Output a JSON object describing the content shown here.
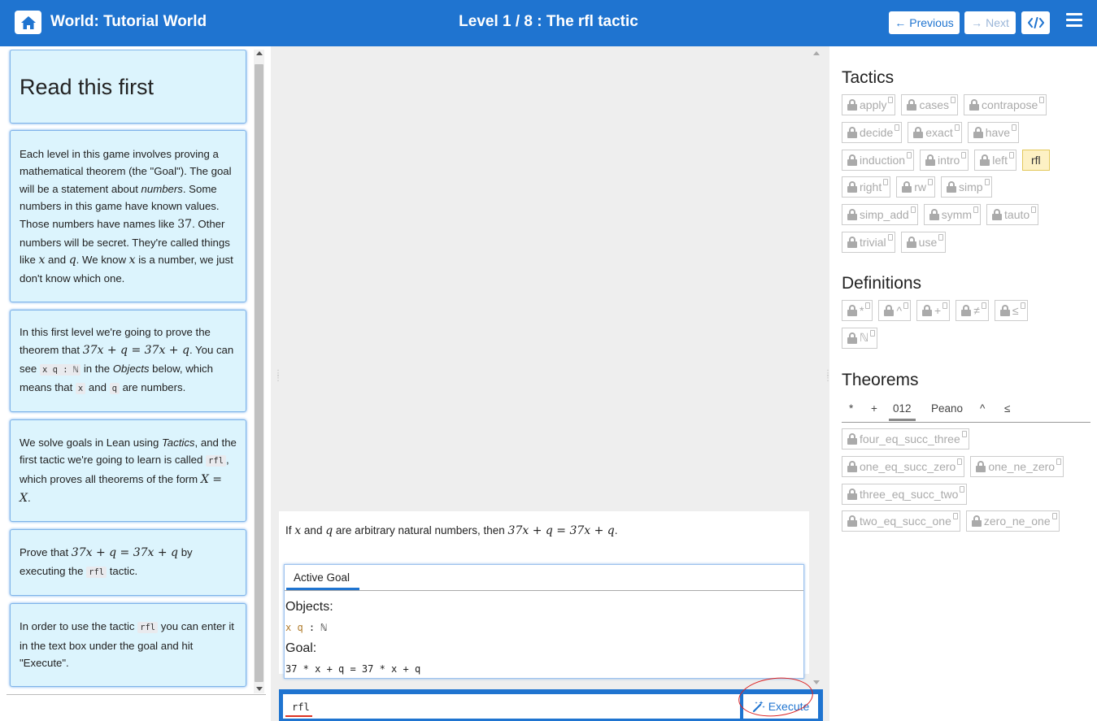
{
  "header": {
    "world_title": "World: Tutorial World",
    "level_title": "Level 1 / 8 : The rfl tactic",
    "previous_label": "Previous",
    "next_label": "Next"
  },
  "intro": {
    "title": "Read this first",
    "p1": {
      "a": "Each level in this game involves proving a mathematical theorem (the \"Goal\"). The goal will be a statement about ",
      "numbers": "numbers",
      "b": ". Some numbers in this game have known values. Those numbers have names like ",
      "num37": "37",
      "c": ". Other numbers will be secret. They're called things like ",
      "x": "x",
      "and": " and ",
      "q": "q",
      "d": ". We know ",
      "x2": "x",
      "e": " is a number, we just don't know which one."
    },
    "p2": {
      "a": "In this first level we're going to prove the theorem that ",
      "eq": "37x + q = 37x + q",
      "b": ". You can see ",
      "code1": "x q : ℕ",
      "c": " in the ",
      "objects": "Objects",
      "d": " below, which means that ",
      "code2": "x",
      "e": " and ",
      "code3": "q",
      "f": " are numbers."
    },
    "p3": {
      "a": "We solve goals in Lean using ",
      "tactics": "Tactics",
      "b": ", and the first tactic we're going to learn is called ",
      "code": "rfl",
      "c": ", which proves all theorems of the form ",
      "eq": "X = X",
      "d": "."
    },
    "p4": {
      "a": "Prove that ",
      "eq": "37x + q = 37x + q",
      "b": " by executing the ",
      "code": "rfl",
      "c": " tactic."
    },
    "p5": {
      "a": "In order to use the tactic ",
      "code": "rfl",
      "b": " you can enter it in the text box under the goal and hit \"Execute\"."
    }
  },
  "statement": {
    "a": "If ",
    "x": "x",
    "b": " and ",
    "q": "q",
    "c": " are arbitrary natural numbers, then ",
    "eq": "37x + q = 37x + q",
    "d": "."
  },
  "goal": {
    "tab": "Active Goal",
    "objects_label": "Objects:",
    "objects_vars": "x q",
    "objects_type": " : ℕ",
    "goal_label": "Goal:",
    "goal_expr": "37 * x + q = 37 * x + q"
  },
  "input": {
    "value": "rfl",
    "execute_label": "Execute"
  },
  "tactics": {
    "title": "Tactics",
    "rows": [
      [
        "apply",
        "cases",
        "contrapose"
      ],
      [
        "decide",
        "exact",
        "have"
      ],
      [
        "induction",
        "intro",
        "left",
        "rfl"
      ],
      [
        "right",
        "rw",
        "simp"
      ],
      [
        "simp_add",
        "symm",
        "tauto"
      ],
      [
        "trivial",
        "use"
      ]
    ],
    "active": "rfl"
  },
  "definitions": {
    "title": "Definitions",
    "rows": [
      [
        "*",
        "^",
        "+",
        "≠",
        "≤"
      ],
      [
        "ℕ"
      ]
    ]
  },
  "theorems": {
    "title": "Theorems",
    "tabs": [
      "*",
      "+",
      "012",
      "Peano",
      "^",
      "≤"
    ],
    "selected_tab": "012",
    "rows": [
      [
        "four_eq_succ_three"
      ],
      [
        "one_eq_succ_zero",
        "one_ne_zero"
      ],
      [
        "three_eq_succ_two"
      ],
      [
        "two_eq_succ_one",
        "zero_ne_one"
      ]
    ]
  },
  "colors": {
    "primary": "#1f74d0",
    "card_bg": "#dcf4fd",
    "active_chip": "#fdf1c4",
    "annotation_red": "#d22"
  }
}
